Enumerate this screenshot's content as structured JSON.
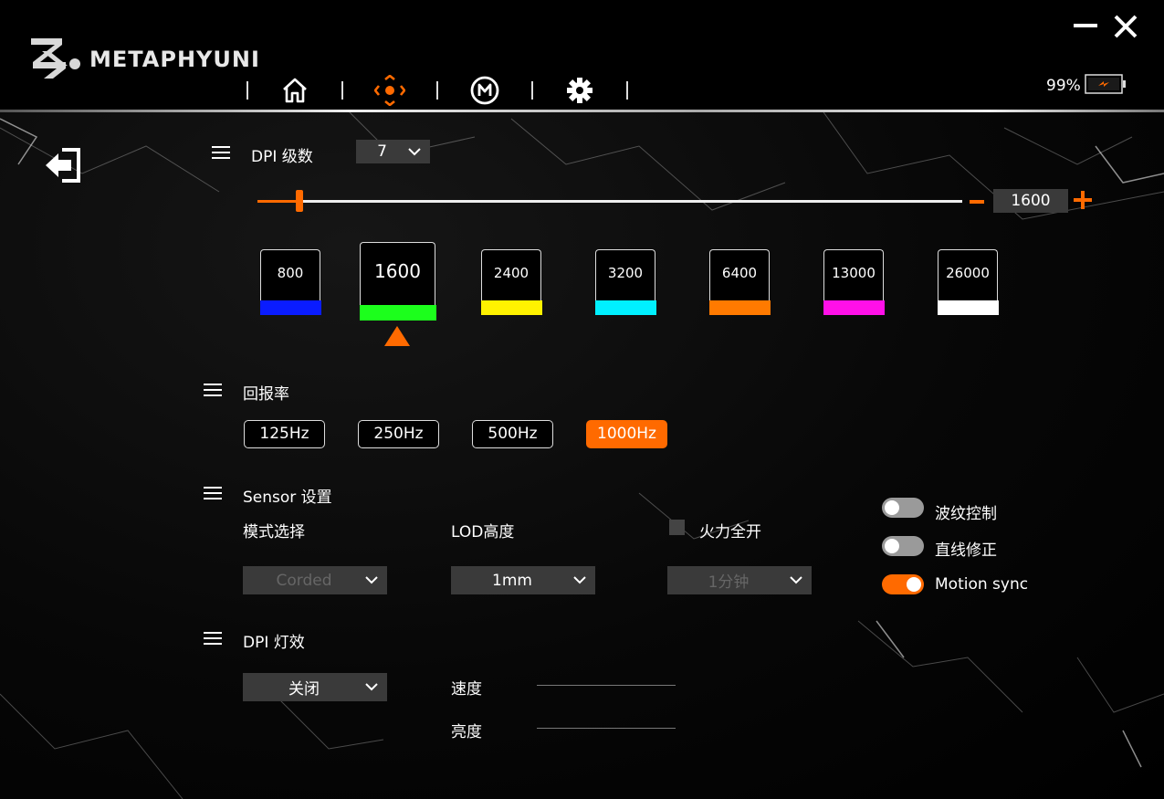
{
  "app": {
    "brand": "METAPHYUNI",
    "battery_percent": "99%"
  },
  "colors": {
    "accent": "#ff6a00",
    "panel": "#3a3a3a"
  },
  "nav": {
    "icons": [
      "home-icon",
      "dpi-crosshair-icon",
      "macro-m-icon",
      "gear-icon"
    ],
    "active_index": 1
  },
  "dpi": {
    "label": "DPI 级数",
    "levels_selected": "7",
    "current_value": "1600",
    "slider_fraction": 0.06,
    "cards": [
      {
        "value": "800",
        "color": "#0a1cff"
      },
      {
        "value": "1600",
        "color": "#1cff1c"
      },
      {
        "value": "2400",
        "color": "#fff200"
      },
      {
        "value": "3200",
        "color": "#00f0ff"
      },
      {
        "value": "6400",
        "color": "#ff7a00"
      },
      {
        "value": "13000",
        "color": "#ff10e8"
      },
      {
        "value": "26000",
        "color": "#ffffff"
      }
    ],
    "selected_index": 1
  },
  "polling": {
    "label": "回报率",
    "options": [
      "125Hz",
      "250Hz",
      "500Hz",
      "1000Hz"
    ],
    "selected": "1000Hz"
  },
  "sensor": {
    "label": "Sensor 设置",
    "mode_label": "模式选择",
    "mode_value": "Corded",
    "lod_label": "LOD高度",
    "lod_value": "1mm",
    "fire_label": "火力全开",
    "fire_value": "1分钟",
    "toggles": [
      {
        "label": "波纹控制",
        "on": false
      },
      {
        "label": "直线修正",
        "on": false
      },
      {
        "label": "Motion sync",
        "on": true
      }
    ]
  },
  "lighting": {
    "label": "DPI 灯效",
    "mode_value": "关闭",
    "speed_label": "速度",
    "brightness_label": "亮度"
  }
}
